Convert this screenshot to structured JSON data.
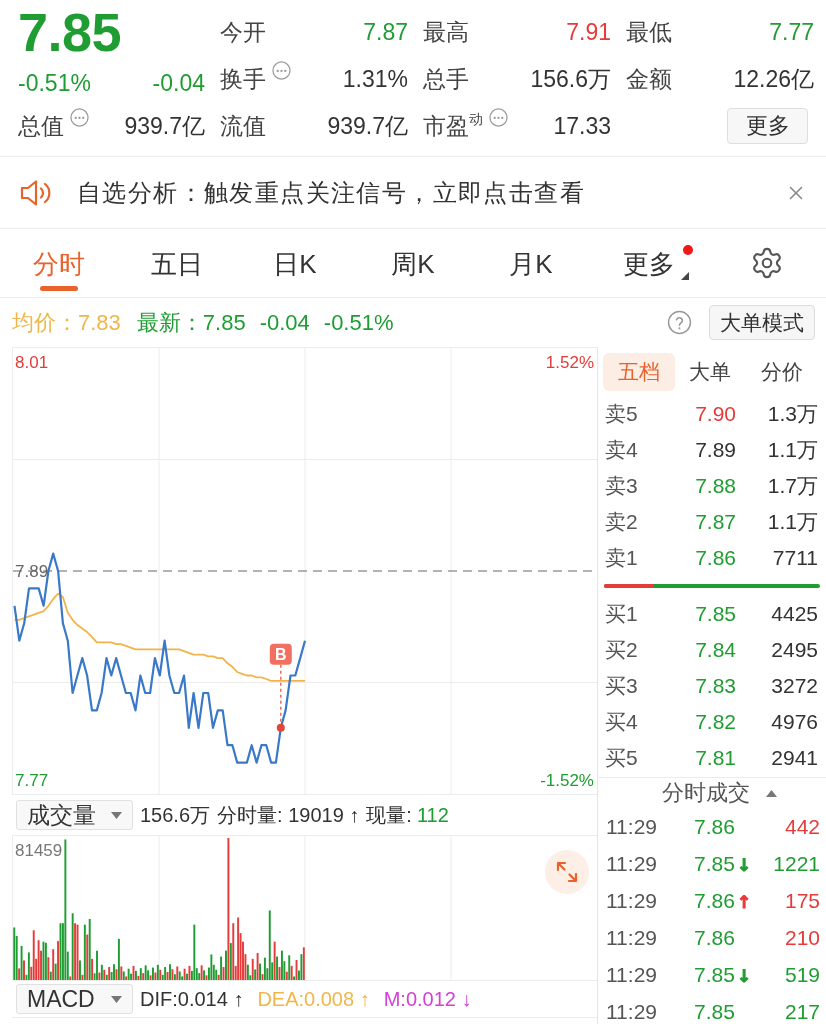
{
  "quote": {
    "price": "7.85",
    "change_percent": "-0.51%",
    "change": "-0.04",
    "color": "#1f9d32"
  },
  "stats": [
    {
      "label": "今开",
      "value": "7.87",
      "color": "#1f9d32",
      "info": false
    },
    {
      "label": "最高",
      "value": "7.91",
      "color": "#e53b3b",
      "info": false
    },
    {
      "label": "最低",
      "value": "7.77",
      "color": "#1f9d32",
      "info": false
    },
    {
      "label": "换手",
      "value": "1.31%",
      "color": "#333333",
      "info": true
    },
    {
      "label": "总手",
      "value": "156.6万",
      "color": "#333333",
      "info": false
    },
    {
      "label": "金额",
      "value": "12.26亿",
      "color": "#333333",
      "info": false
    },
    {
      "label": "总值",
      "value": "939.7亿",
      "color": "#333333",
      "info": true
    },
    {
      "label": "流值",
      "value": "939.7亿",
      "color": "#333333",
      "info": false
    },
    {
      "label": "市盈$^{动}$",
      "value": "17.33",
      "color": "#333333",
      "info": true
    }
  ],
  "more_button": "更多",
  "notice": {
    "text": "自选分析：触发重点关注信号，立即点击查看"
  },
  "period_tabs": [
    {
      "label": "分时",
      "selected": true,
      "badge_dot": false,
      "dropdown": false
    },
    {
      "label": "五日",
      "selected": false,
      "badge_dot": false,
      "dropdown": false
    },
    {
      "label": "日K",
      "selected": false,
      "badge_dot": false,
      "dropdown": false
    },
    {
      "label": "周K",
      "selected": false,
      "badge_dot": false,
      "dropdown": false
    },
    {
      "label": "月K",
      "selected": false,
      "badge_dot": false,
      "dropdown": false
    },
    {
      "label": "更多",
      "selected": false,
      "badge_dot": true,
      "dropdown": true
    }
  ],
  "price_summary": {
    "average": {
      "label": "均价：",
      "value": "7.83"
    },
    "latest": {
      "label": "最新：",
      "value": "7.85",
      "change": "-0.04",
      "change_percent": "-0.51%",
      "color": "#1f9d32"
    },
    "mode_button": "大单模式"
  },
  "price_chart": {
    "chart_data": {
      "type": "line",
      "ylim": [
        7.762,
        8.018
      ],
      "yticks": [
        {
          "value": 7.77,
          "label": "7.77"
        },
        {
          "value": 7.89,
          "label": "7.89"
        },
        {
          "value": 8.01,
          "label": "8.01"
        }
      ],
      "categories": [
        null,
        null,
        null,
        null,
        null,
        null,
        null,
        null,
        null,
        null,
        null,
        null,
        null,
        null,
        null,
        null,
        null,
        null,
        null,
        null,
        null,
        null,
        null,
        null,
        null,
        null,
        null,
        null,
        null,
        null,
        null,
        null,
        null,
        null,
        null,
        null,
        null,
        null,
        null,
        null,
        null,
        null,
        null,
        null,
        null,
        null,
        null,
        null,
        null,
        null,
        null,
        null,
        null,
        null,
        null,
        null,
        null,
        null,
        null,
        null,
        null,
        null,
        null,
        null,
        null,
        null,
        null,
        null,
        null,
        null,
        null,
        null,
        null,
        null,
        null,
        null,
        null,
        null,
        null,
        null,
        null,
        null,
        null,
        null,
        null,
        null,
        null,
        null,
        null,
        null,
        null,
        null,
        null,
        null,
        null,
        null,
        null,
        null,
        null,
        null,
        null,
        null,
        null,
        null,
        null,
        null,
        null,
        null,
        null,
        null,
        null,
        null,
        null,
        null,
        null,
        null,
        null,
        null,
        null,
        null,
        null
      ],
      "series": [
        {
          "color": "#3a78c8",
          "values": [
            7.87,
            7.85,
            7.86,
            7.88,
            7.88,
            7.88,
            7.87,
            7.89,
            7.9,
            7.89,
            7.86,
            7.85,
            7.82,
            7.83,
            7.84,
            7.83,
            7.81,
            7.81,
            7.82,
            7.84,
            7.83,
            7.84,
            7.83,
            7.82,
            7.82,
            7.81,
            7.83,
            7.82,
            7.82,
            7.84,
            7.83,
            7.85,
            7.83,
            7.82,
            7.82,
            7.83,
            7.8,
            7.82,
            7.8,
            7.82,
            7.82,
            7.8,
            7.81,
            7.81,
            7.79,
            7.79,
            7.78,
            7.78,
            7.78,
            7.79,
            7.78,
            7.79,
            7.79,
            7.78,
            7.78,
            7.8,
            7.81,
            7.83,
            7.83,
            7.84,
            7.85,
            null,
            null,
            null,
            null,
            null,
            null,
            null,
            null,
            null,
            null,
            null,
            null,
            null,
            null,
            null,
            null,
            null,
            null,
            null,
            null,
            null,
            null,
            null,
            null,
            null,
            null,
            null,
            null,
            null,
            null,
            null,
            null,
            null,
            null,
            null,
            null,
            null,
            null,
            null,
            null,
            null,
            null,
            null,
            null,
            null,
            null,
            null,
            null,
            null,
            null,
            null,
            null,
            null,
            null,
            null,
            null,
            null,
            null,
            null,
            null
          ]
        },
        {
          "color": "#f2b44a",
          "values": [
            7.862,
            7.862,
            7.863,
            7.864,
            7.865,
            7.866,
            7.867,
            7.87,
            7.874,
            7.877,
            7.875,
            7.866,
            7.862,
            7.859,
            7.857,
            7.855,
            7.852,
            7.849,
            7.849,
            7.849,
            7.849,
            7.848,
            7.848,
            7.847,
            7.846,
            7.845,
            7.845,
            7.845,
            7.845,
            7.845,
            7.845,
            7.845,
            7.845,
            7.845,
            7.845,
            7.844,
            7.843,
            7.842,
            7.842,
            7.842,
            7.841,
            7.841,
            7.84,
            7.84,
            7.837,
            7.835,
            7.832,
            7.831,
            7.83,
            7.83,
            7.829,
            7.829,
            7.828,
            7.827,
            7.827,
            7.827,
            7.827,
            7.827,
            7.827,
            7.827,
            7.827,
            null,
            null,
            null,
            null,
            null,
            null,
            null,
            null,
            null,
            null,
            null,
            null,
            null,
            null,
            null,
            null,
            null,
            null,
            null,
            null,
            null,
            null,
            null,
            null,
            null,
            null,
            null,
            null,
            null,
            null,
            null,
            null,
            null,
            null,
            null,
            null,
            null,
            null,
            null,
            null,
            null,
            null,
            null,
            null,
            null,
            null,
            null,
            null,
            null,
            null,
            null,
            null,
            null,
            null,
            null,
            null,
            null,
            null,
            null,
            null
          ]
        }
      ],
      "ref_lines": [
        {
          "axis": "y",
          "value": 7.89
        }
      ],
      "annotations": [
        {
          "y": 7.8,
          "text": "B"
        }
      ]
    },
    "percent_ticks": [
      {
        "label": "1.52%",
        "color": "#e53b3b"
      },
      {
        "label": "-1.52%",
        "color": "#1f9d32"
      }
    ]
  },
  "volume_panel": {
    "indicator": "成交量",
    "total": "156.6万",
    "minute_volume": "分时量: 19019 ↑",
    "current": {
      "label": "现量:",
      "value": "112",
      "color": "#1f9d32"
    },
    "max_label": "81459"
  },
  "macd_panel": {
    "indicator": "MACD",
    "values": [
      {
        "text": "DIF:0.014 ↑",
        "color": "#333333"
      },
      {
        "text": "DEA:0.008 ↑",
        "color": "#f0b64a"
      },
      {
        "text": "M:0.012 ↓",
        "color": "#d43fd6"
      }
    ]
  },
  "order_book": {
    "tabs": [
      {
        "label": "五档",
        "selected": true
      },
      {
        "label": "大单",
        "selected": false
      },
      {
        "label": "分价",
        "selected": false
      }
    ],
    "asks": [
      {
        "label": "卖5",
        "price": "7.90",
        "color": "#e53b3b",
        "volume": "1.3万"
      },
      {
        "label": "卖4",
        "price": "7.89",
        "color": "#333333",
        "volume": "1.1万"
      },
      {
        "label": "卖3",
        "price": "7.88",
        "color": "#1f9d32",
        "volume": "1.7万"
      },
      {
        "label": "卖2",
        "price": "7.87",
        "color": "#1f9d32",
        "volume": "1.1万"
      },
      {
        "label": "卖1",
        "price": "7.86",
        "color": "#1f9d32",
        "volume": "7711"
      }
    ],
    "ratio_bar": {
      "level": 0.23
    },
    "bids": [
      {
        "label": "买1",
        "price": "7.85",
        "color": "#1f9d32",
        "volume": "4425"
      },
      {
        "label": "买2",
        "price": "7.84",
        "color": "#1f9d32",
        "volume": "2495"
      },
      {
        "label": "买3",
        "price": "7.83",
        "color": "#1f9d32",
        "volume": "3272"
      },
      {
        "label": "买4",
        "price": "7.82",
        "color": "#1f9d32",
        "volume": "4976"
      },
      {
        "label": "买5",
        "price": "7.81",
        "color": "#1f9d32",
        "volume": "2941"
      }
    ]
  },
  "trades": {
    "title": "分时成交",
    "rows": [
      {
        "time": "11:29",
        "price": {
          "text": "7.86",
          "color": "#1f9d32"
        },
        "volume": {
          "text": "442",
          "color": "#e53b3b"
        }
      },
      {
        "time": "11:29",
        "price": {
          "text": "7.85",
          "color": "#1f9d32"
        },
        "arrow": {
          "text": "↓",
          "color": "#1f9d32"
        },
        "volume": {
          "text": "1221",
          "color": "#1f9d32"
        }
      },
      {
        "time": "11:29",
        "price": {
          "text": "7.86",
          "color": "#1f9d32"
        },
        "arrow": {
          "text": "↑",
          "color": "#e53b3b"
        },
        "volume": {
          "text": "175",
          "color": "#e53b3b"
        }
      },
      {
        "time": "11:29",
        "price": {
          "text": "7.86",
          "color": "#1f9d32"
        },
        "volume": {
          "text": "210",
          "color": "#e53b3b"
        }
      },
      {
        "time": "11:29",
        "price": {
          "text": "7.85",
          "color": "#1f9d32"
        },
        "arrow": {
          "text": "↓",
          "color": "#1f9d32"
        },
        "volume": {
          "text": "519",
          "color": "#1f9d32"
        }
      },
      {
        "time": "11:29",
        "price": {
          "text": "7.85",
          "color": "#1f9d32"
        },
        "volume": {
          "text": "217",
          "color": "#1f9d32"
        }
      }
    ]
  }
}
